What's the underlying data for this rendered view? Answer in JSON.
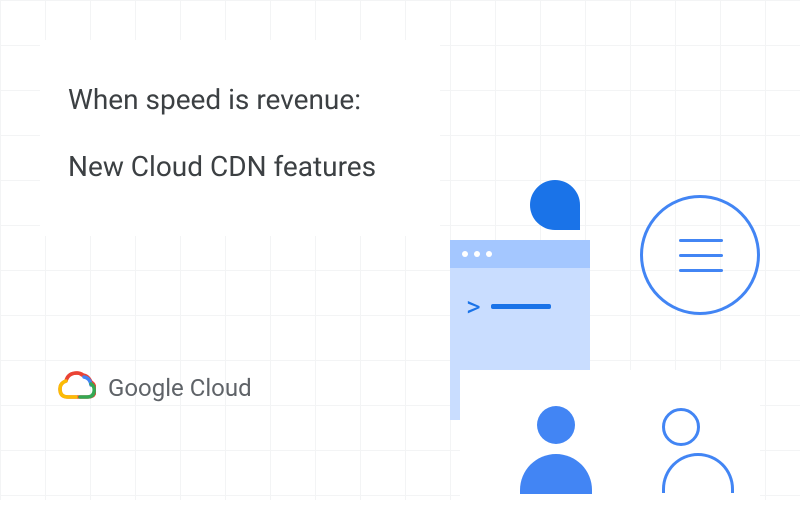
{
  "title": {
    "line1": "When speed is revenue:",
    "line2": "New Cloud CDN features"
  },
  "brand": {
    "name": "Google Cloud"
  }
}
